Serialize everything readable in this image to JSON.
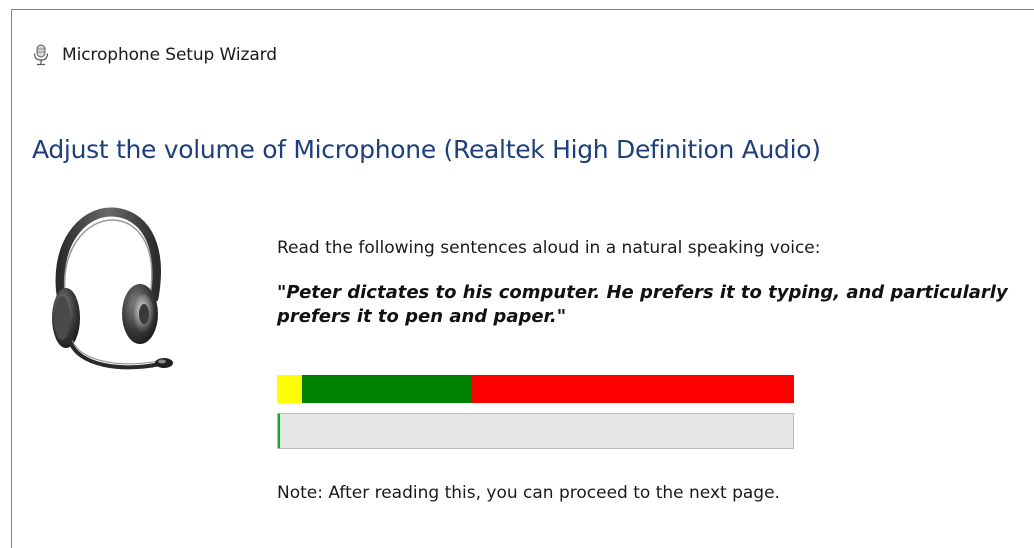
{
  "window": {
    "title": "Microphone Setup Wizard",
    "icon": "microphone-icon"
  },
  "page": {
    "heading": "Adjust the volume of Microphone (Realtek High Definition Audio)",
    "illustration": "headset-icon",
    "instruction": "Read the following sentences aloud in a natural speaking voice:",
    "quote": "\"Peter dictates to his computer. He prefers it to typing, and particularly prefers it to pen and paper.\"",
    "note": "Note: After reading this, you can proceed to the next page."
  },
  "volume_meter": {
    "zones": [
      {
        "name": "low",
        "color": "#ffff00",
        "fraction": 0.048
      },
      {
        "name": "optimal",
        "color": "#008000",
        "fraction": 0.327
      },
      {
        "name": "high",
        "color": "#ff0000",
        "fraction": 0.625
      }
    ],
    "current_level": 0.003,
    "fill_color": "#06b025",
    "track_color": "#e6e6e6"
  },
  "colors": {
    "heading": "#1e3f7a",
    "window_border": "#4a90d9"
  }
}
